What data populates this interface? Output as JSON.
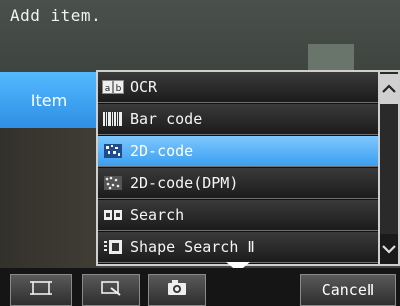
{
  "title": "Add item.",
  "left_tab": {
    "label": "Item"
  },
  "menu": {
    "items": [
      {
        "label": "OCR",
        "icon": "ocr-icon",
        "selected": false
      },
      {
        "label": "Bar code",
        "icon": "barcode-icon",
        "selected": false
      },
      {
        "label": "2D-code",
        "icon": "2d-code-icon",
        "selected": true
      },
      {
        "label": "2D-code(DPM)",
        "icon": "2d-code-dpm-icon",
        "selected": false
      },
      {
        "label": "Search",
        "icon": "search-icon",
        "selected": false
      },
      {
        "label": "Shape Search Ⅱ",
        "icon": "shape-search-icon",
        "selected": false
      }
    ]
  },
  "toolbar": {
    "buttons": [
      {
        "icon": "frame-icon"
      },
      {
        "icon": "zoom-area-icon"
      },
      {
        "icon": "camera-icon"
      }
    ],
    "cancel_label": "CanceⅡ"
  },
  "colors": {
    "accent": "#3b9ff0",
    "tab_top": "#54b9ff",
    "panel_border": "#cfcfcf"
  }
}
